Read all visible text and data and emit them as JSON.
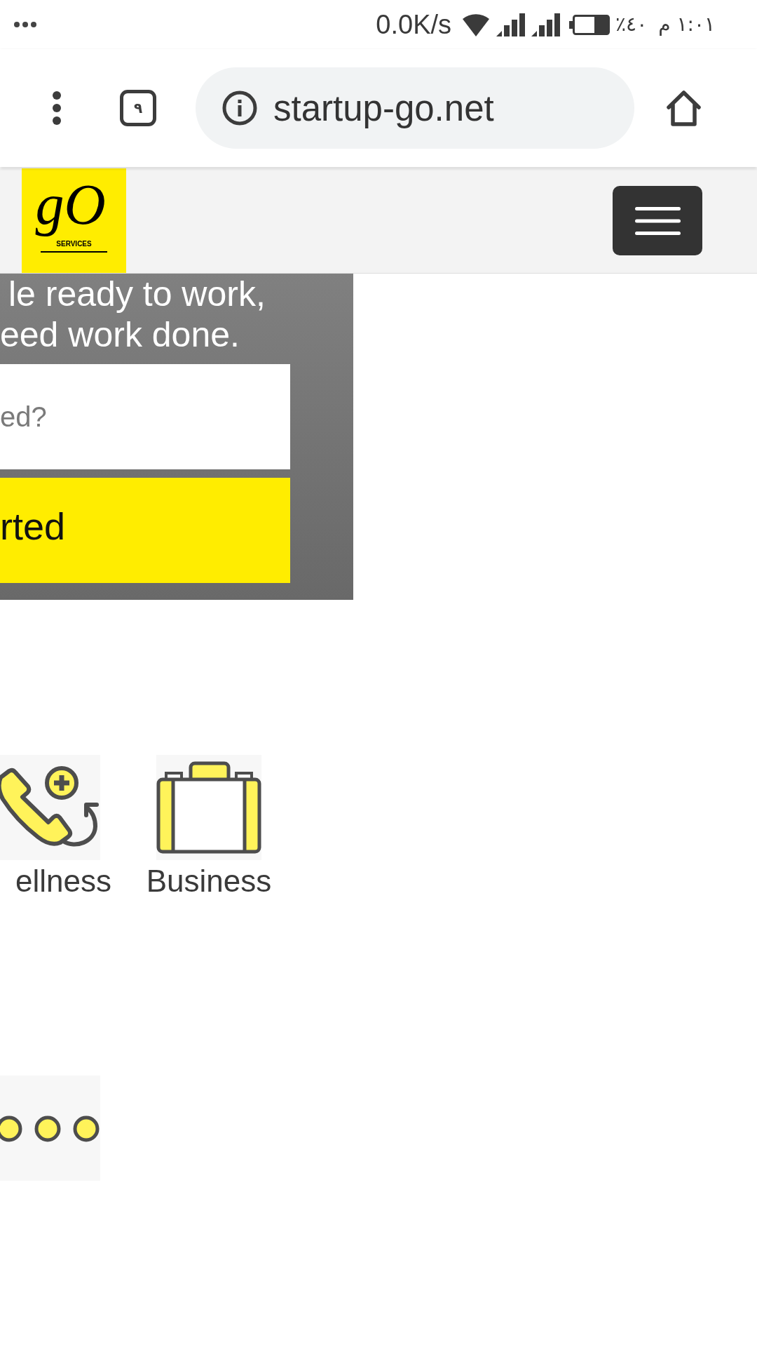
{
  "status_bar": {
    "network_speed": "0.0K/s",
    "battery_percent": "٪٤٠",
    "time": "١:٠١ م"
  },
  "browser_toolbar": {
    "tab_count": "٩",
    "url": "startup-go.net"
  },
  "site_header": {
    "logo": {
      "wordmark": "gO",
      "tagline": "SERVICES"
    }
  },
  "hero": {
    "heading_lines": [
      "le ready to work,",
      "eed work done."
    ],
    "search_field": {
      "placeholder": "ed?"
    },
    "button": "rted"
  },
  "categories": [
    {
      "kind": "phone",
      "label": "ellness"
    },
    {
      "kind": "briefcase",
      "label": "Business"
    },
    {
      "kind": "dots"
    }
  ]
}
